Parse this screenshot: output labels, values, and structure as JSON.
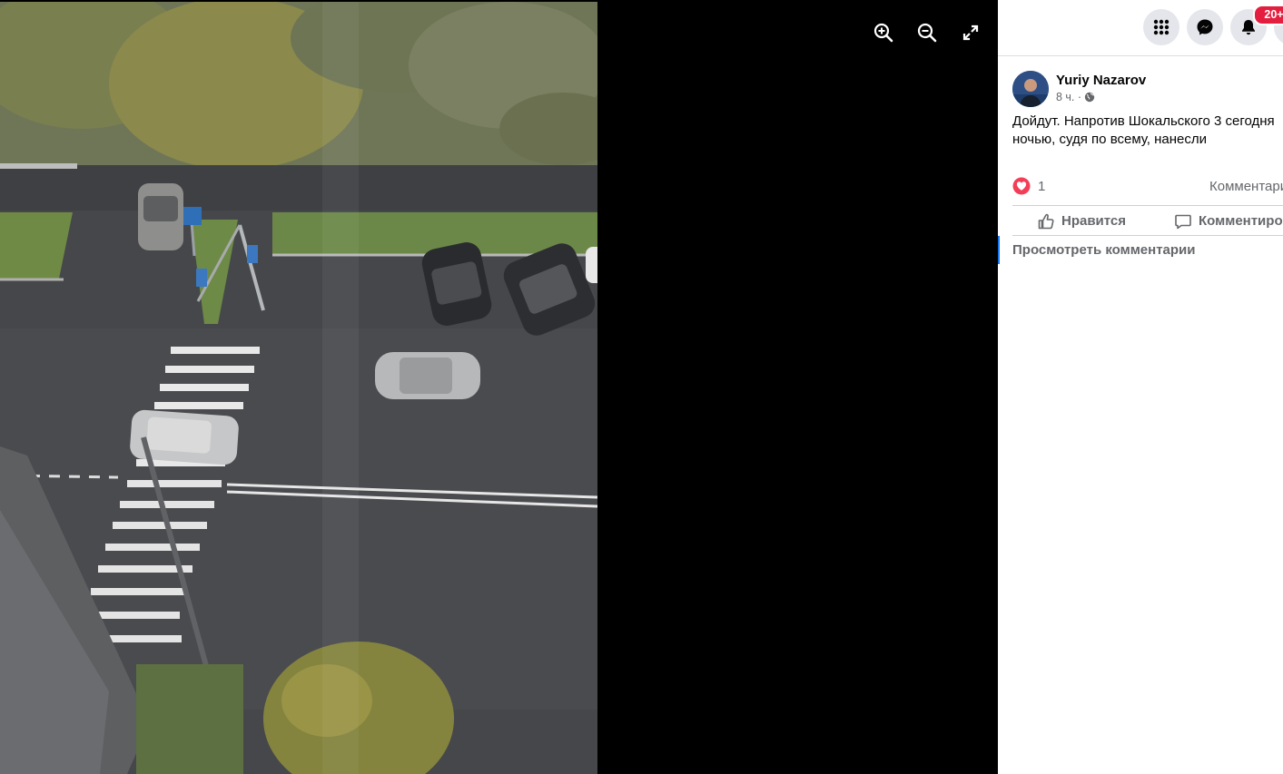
{
  "viewer": {
    "zoom_in_label": "zoom-in",
    "zoom_out_label": "zoom-out",
    "fullscreen_label": "fullscreen"
  },
  "topbar": {
    "menu_icon": "grid-menu-icon",
    "messenger_icon": "messenger-icon",
    "notifications_icon": "bell-icon",
    "notifications_badge": "20+"
  },
  "post": {
    "author": "Yuriy Nazarov",
    "time": "8 ч. ·",
    "privacy_icon": "globe-icon",
    "text": "Дойдут. Напротив Шокальского 3 сегодня ночью, судя по всему, нанесли",
    "reaction_count": "1",
    "comments_label": "Комментарии",
    "like_label": "Нравится",
    "comment_label": "Комментировать",
    "view_comments_label": "Просмотреть комментарии"
  },
  "colors": {
    "accent": "#1877f2",
    "badge": "#e41e3f",
    "love": "#f33e58",
    "muted_text": "#65676b"
  }
}
